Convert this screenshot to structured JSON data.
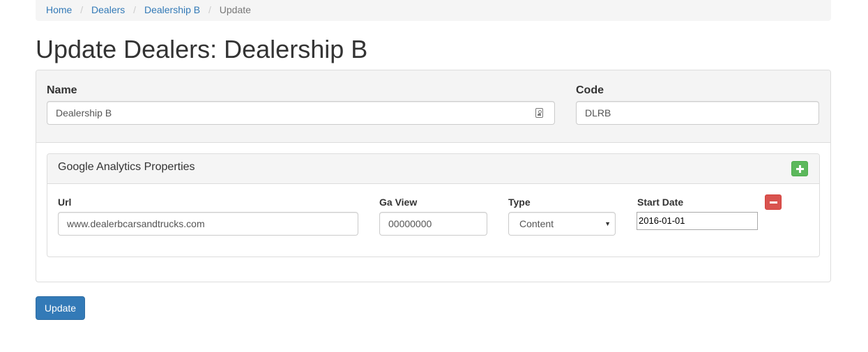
{
  "breadcrumb": {
    "items": [
      "Home",
      "Dealers",
      "Dealership B"
    ],
    "separator": "/",
    "active": "Update"
  },
  "page_title": "Update Dealers: Dealership B",
  "form": {
    "name_label": "Name",
    "name_value": "Dealership B",
    "code_label": "Code",
    "code_value": "DLRB"
  },
  "ga_panel": {
    "title": "Google Analytics Properties",
    "add_icon": "plus-icon",
    "remove_icon": "minus-icon",
    "row": {
      "url_label": "Url",
      "url_value": "www.dealerbcarsandtrucks.com",
      "gaview_label": "Ga View",
      "gaview_value": "00000000",
      "type_label": "Type",
      "type_value": "Content",
      "start_date_label": "Start Date",
      "start_date_value": "2016-01-01"
    }
  },
  "update_button": "Update",
  "colors": {
    "link": "#337ab7",
    "primary": "#337ab7",
    "success": "#5cb85c",
    "danger": "#d9534f"
  }
}
